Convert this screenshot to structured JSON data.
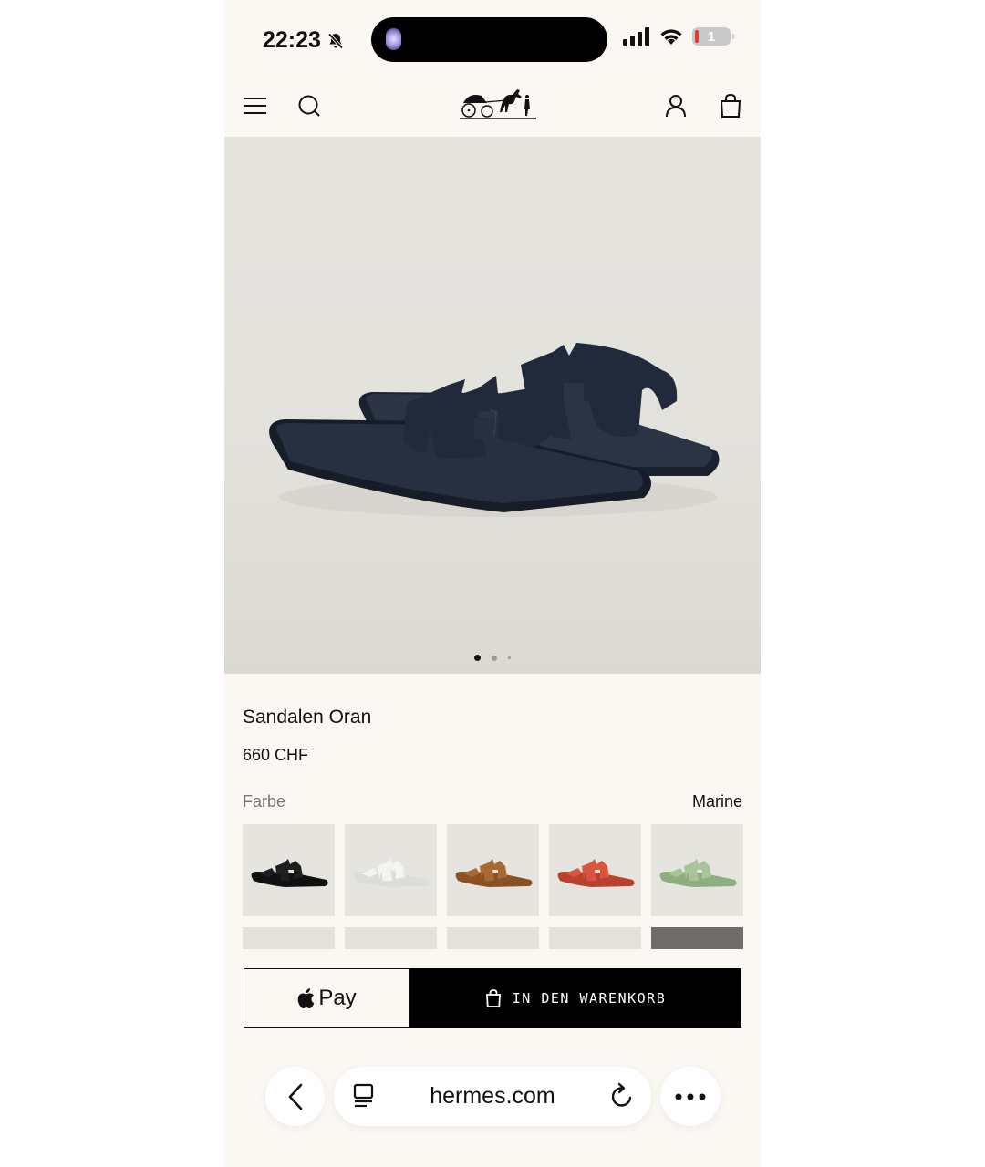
{
  "status_bar": {
    "time": "22:23",
    "battery_level": "1"
  },
  "header": {
    "menu_icon": "menu-icon",
    "search_icon": "search-icon",
    "logo_icon": "horse-carriage-logo-icon",
    "account_icon": "user-icon",
    "bag_icon": "shopping-bag-icon"
  },
  "gallery": {
    "image_count": 3,
    "active_index": 0
  },
  "product": {
    "title": "Sandalen Oran",
    "price": "660 CHF",
    "color_label": "Farbe",
    "color_selected": "Marine"
  },
  "swatches": [
    {
      "name": "black",
      "color": "#1e1e1e",
      "sole": "#111111"
    },
    {
      "name": "white",
      "color": "#f4f4f2",
      "sole": "#dcdcd8"
    },
    {
      "name": "tan",
      "color": "#a86a32",
      "sole": "#8a5224"
    },
    {
      "name": "red",
      "color": "#d9553f",
      "sole": "#b8422f"
    },
    {
      "name": "sage",
      "color": "#a9c498",
      "sole": "#8fae7f"
    }
  ],
  "actions": {
    "apple_pay_label": "Pay",
    "add_to_cart_label": "IN DEN WARENKORB"
  },
  "browser": {
    "url": "hermes.com"
  },
  "colors": {
    "background": "#fbf8f4",
    "button_dark": "#000000",
    "sandal_marine": "#1f2838"
  }
}
